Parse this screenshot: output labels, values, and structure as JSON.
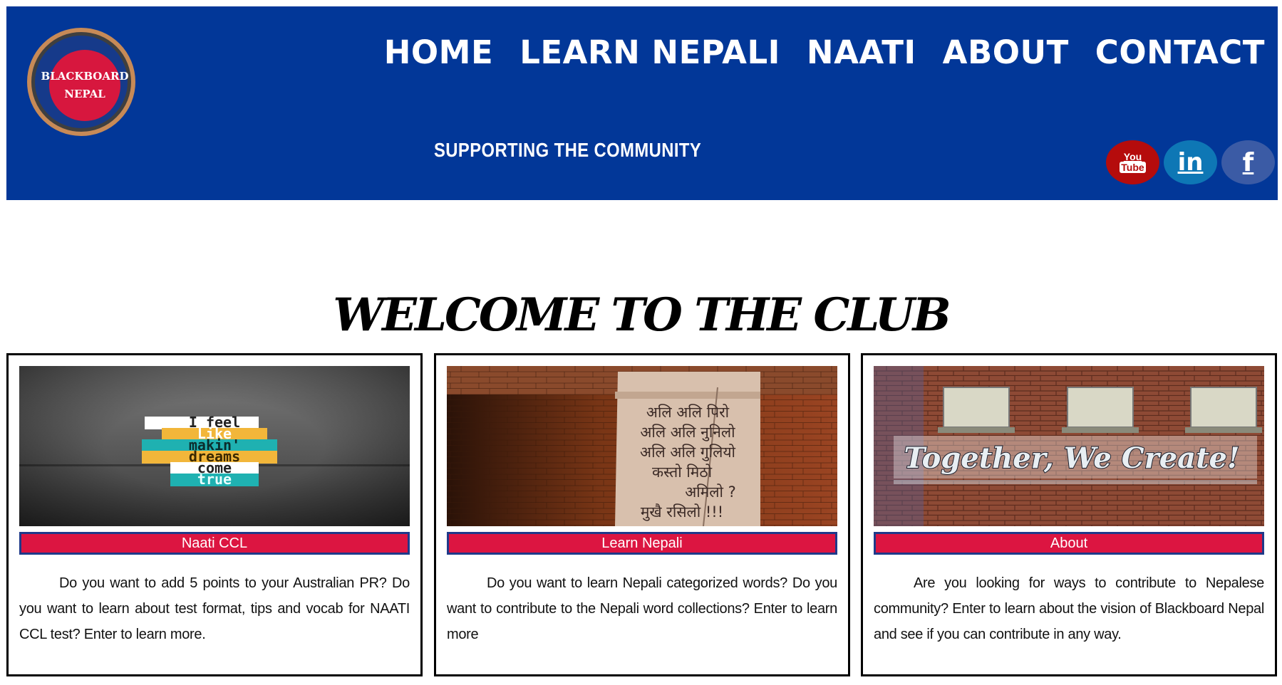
{
  "header": {
    "logo_line1": "BLACKBOARD",
    "logo_line2": "NEPAL",
    "tagline": "SUPPORTING THE COMMUNITY",
    "nav": [
      "HOME",
      "LEARN NEPALI",
      "NAATI",
      "ABOUT",
      "CONTACT"
    ],
    "social": {
      "youtube": {
        "line1": "You",
        "line2": "Tube",
        "icon": "youtube-icon"
      },
      "linkedin": {
        "text": "in",
        "icon": "linkedin-icon"
      },
      "facebook": {
        "text": "f",
        "icon": "facebook-icon"
      }
    }
  },
  "main": {
    "welcome_title": "WELCOME TO THE CLUB",
    "cards": [
      {
        "button": "Naati CCL",
        "image_text": [
          "I feel",
          "Like",
          "makin'",
          "dreams",
          "come",
          "true"
        ],
        "text": "Do you want to add 5 points to your Australian PR? Do you want to learn about test format, tips and vocab for NAATI CCL test? Enter to learn more."
      },
      {
        "button": "Learn Nepali",
        "image_text": [
          "अलि अलि पिरो",
          "अलि अलि नुनिलो",
          "अलि अलि गुलियो",
          "कस्तो मिठो",
          "अमिलो ?",
          "मुखै रसिलो !!!"
        ],
        "text": "Do you want to learn Nepali categorized words? Do you want to contribute to the Nepali word collections? Enter to learn more"
      },
      {
        "button": "About",
        "image_text": [
          "Together, We Create!"
        ],
        "text": "Are you looking for ways to contribute to Nepalese community? Enter to learn about the vision of Blackboard Nepal and see if you can contribute in any way."
      }
    ]
  },
  "colors": {
    "header_bg": "#023798",
    "button_bg": "#dc1541",
    "button_border": "#1f3a8a"
  }
}
